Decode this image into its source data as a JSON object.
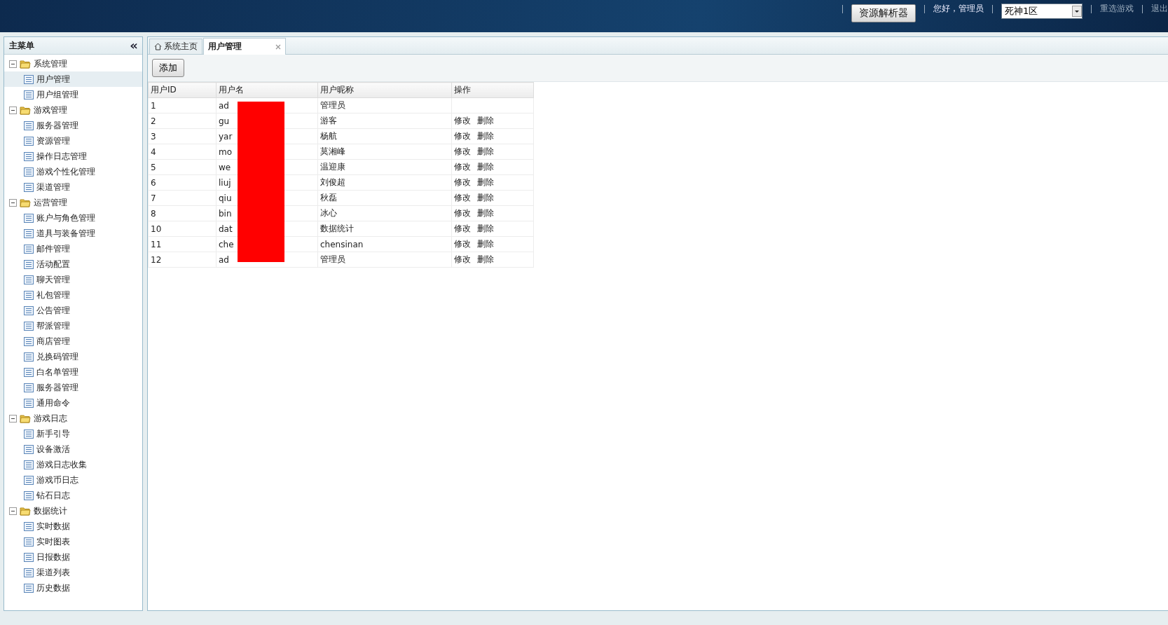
{
  "header": {
    "resource_button": "资源解析器",
    "greeting": "您好，管理员",
    "server_select": {
      "value": "死神1区"
    },
    "links": [
      "重选游戏",
      "退出"
    ]
  },
  "sidebar": {
    "title": "主菜单",
    "collapse_icon": "«",
    "items": [
      {
        "label": "系统管理",
        "expanded": true,
        "children": [
          {
            "label": "用户管理",
            "selected": true
          },
          {
            "label": "用户组管理",
            "selected": false
          }
        ]
      },
      {
        "label": "游戏管理",
        "expanded": true,
        "children": [
          {
            "label": "服务器管理",
            "selected": false
          },
          {
            "label": "资源管理",
            "selected": false
          },
          {
            "label": "操作日志管理",
            "selected": false
          },
          {
            "label": "游戏个性化管理",
            "selected": false
          },
          {
            "label": "渠道管理",
            "selected": false
          }
        ]
      },
      {
        "label": "运营管理",
        "expanded": true,
        "children": [
          {
            "label": "账户与角色管理",
            "selected": false
          },
          {
            "label": "道具与装备管理",
            "selected": false
          },
          {
            "label": "邮件管理",
            "selected": false
          },
          {
            "label": "活动配置",
            "selected": false
          },
          {
            "label": "聊天管理",
            "selected": false
          },
          {
            "label": "礼包管理",
            "selected": false
          },
          {
            "label": "公告管理",
            "selected": false
          },
          {
            "label": "帮派管理",
            "selected": false
          },
          {
            "label": "商店管理",
            "selected": false
          },
          {
            "label": "兑换码管理",
            "selected": false
          },
          {
            "label": "白名单管理",
            "selected": false
          },
          {
            "label": "服务器管理",
            "selected": false
          },
          {
            "label": "通用命令",
            "selected": false
          }
        ]
      },
      {
        "label": "游戏日志",
        "expanded": true,
        "children": [
          {
            "label": "新手引导",
            "selected": false
          },
          {
            "label": "设备激活",
            "selected": false
          },
          {
            "label": "游戏日志收集",
            "selected": false
          },
          {
            "label": "游戏币日志",
            "selected": false
          },
          {
            "label": "钻石日志",
            "selected": false
          }
        ]
      },
      {
        "label": "数据统计",
        "expanded": true,
        "children": [
          {
            "label": "实时数据",
            "selected": false
          },
          {
            "label": "实时图表",
            "selected": false
          },
          {
            "label": "日报数据",
            "selected": false
          },
          {
            "label": "渠道列表",
            "selected": false
          },
          {
            "label": "历史数据",
            "selected": false
          }
        ]
      }
    ]
  },
  "tabs": [
    {
      "label": "系统主页",
      "kind": "home",
      "selected": false
    },
    {
      "label": "用户管理",
      "kind": "closable",
      "selected": true
    }
  ],
  "toolbar": {
    "add_button": "添加"
  },
  "table": {
    "columns": [
      "用户ID",
      "用户名",
      "用户昵称",
      "操作"
    ],
    "redacted": true,
    "rows": [
      {
        "id": "1",
        "username": "ad",
        "nickname": "管理员",
        "actions": []
      },
      {
        "id": "2",
        "username": "gu",
        "nickname": "游客",
        "actions": [
          "修改",
          "删除"
        ]
      },
      {
        "id": "3",
        "username": "yar",
        "nickname": "杨航",
        "actions": [
          "修改",
          "删除"
        ]
      },
      {
        "id": "4",
        "username": "mo",
        "nickname": "莫湘峰",
        "actions": [
          "修改",
          "删除"
        ]
      },
      {
        "id": "5",
        "username": "we",
        "nickname": "温迎康",
        "actions": [
          "修改",
          "删除"
        ]
      },
      {
        "id": "6",
        "username": "liuj",
        "nickname": "刘俊超",
        "actions": [
          "修改",
          "删除"
        ]
      },
      {
        "id": "7",
        "username": "qiu",
        "nickname": "秋磊",
        "actions": [
          "修改",
          "删除"
        ]
      },
      {
        "id": "8",
        "username": "bin",
        "nickname": "冰心",
        "actions": [
          "修改",
          "删除"
        ]
      },
      {
        "id": "10",
        "username": "dat",
        "nickname": "数据统计",
        "actions": [
          "修改",
          "删除"
        ]
      },
      {
        "id": "11",
        "username": "che",
        "nickname": "chensinan",
        "actions": [
          "修改",
          "删除"
        ]
      },
      {
        "id": "12",
        "username": "ad",
        "nickname": "管理员",
        "actions": [
          "修改",
          "删除"
        ]
      }
    ]
  }
}
